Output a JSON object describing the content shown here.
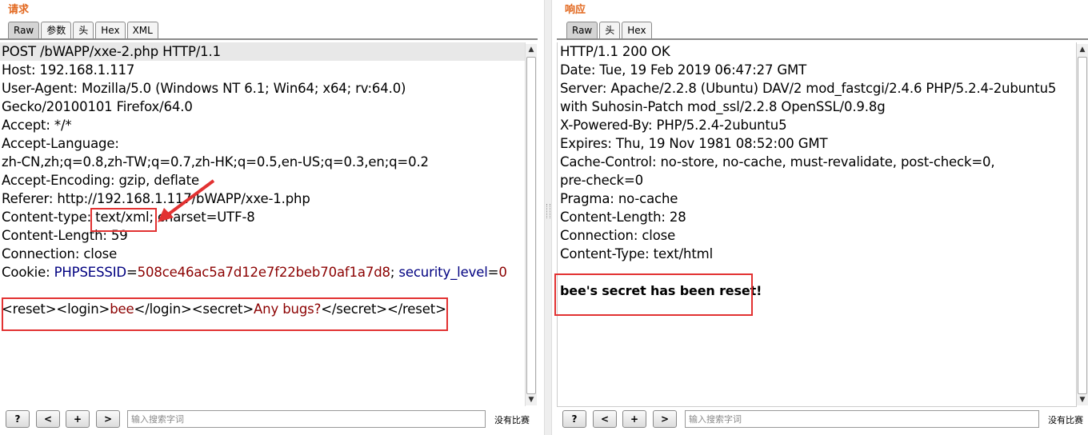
{
  "request": {
    "title": "请求",
    "tabs": [
      "Raw",
      "参数",
      "头",
      "Hex",
      "XML"
    ],
    "lines": [
      "POST /bWAPP/xxe-2.php HTTP/1.1",
      "Host: 192.168.1.117",
      "User-Agent: Mozilla/5.0 (Windows NT 6.1; Win64; x64; rv:64.0)",
      "Gecko/20100101 Firefox/64.0",
      "Accept: */*",
      "Accept-Language:",
      "zh-CN,zh;q=0.8,zh-TW;q=0.7,zh-HK;q=0.5,en-US;q=0.3,en;q=0.2",
      "Accept-Encoding: gzip, deflate",
      "Referer: http://192.168.1.117/bWAPP/xxe-1.php",
      "Content-type: text/xml; charset=UTF-8",
      "Content-Length: 59",
      "Connection: close"
    ],
    "cookie": {
      "prefix": "Cookie: ",
      "name1": "PHPSESSID",
      "eq1": "=",
      "value1": "508ce46ac5a7d12e7f22beb70af1a7d8",
      "sep": "; ",
      "name2": "security_level",
      "eq2": "=",
      "value2": "0"
    },
    "body": {
      "reset_open": "<reset>",
      "login_open": "<login>",
      "login_value": "bee",
      "login_close": "</login>",
      "secret_open": "<secret>",
      "secret_value": "Any bugs?",
      "secret_close": "</secret>",
      "reset_close": "</reset>"
    },
    "search_placeholder": "输入搜索字词",
    "match_text": "没有比赛"
  },
  "response": {
    "title": "响应",
    "tabs": [
      "Raw",
      "头",
      "Hex"
    ],
    "lines": [
      "HTTP/1.1 200 OK",
      "Date: Tue, 19 Feb 2019 06:47:27 GMT",
      "Server: Apache/2.2.8 (Ubuntu) DAV/2 mod_fastcgi/2.4.6 PHP/5.2.4-2ubuntu5",
      "with Suhosin-Patch mod_ssl/2.2.8 OpenSSL/0.9.8g",
      "X-Powered-By: PHP/5.2.4-2ubuntu5",
      "Expires: Thu, 19 Nov 1981 08:52:00 GMT",
      "Cache-Control: no-store, no-cache, must-revalidate, post-check=0,",
      "pre-check=0",
      "Pragma: no-cache",
      "Content-Length: 28",
      "Connection: close",
      "Content-Type: text/html"
    ],
    "body": "bee's secret has been reset!",
    "search_placeholder": "输入搜索字词",
    "match_text": "没有比赛"
  },
  "nav_buttons": [
    "?",
    "<",
    "+",
    ">"
  ],
  "colors": {
    "title": "#e2681f",
    "highlight": "#e23232",
    "xml_value": "#8b0000",
    "cookie_name": "#000080"
  }
}
